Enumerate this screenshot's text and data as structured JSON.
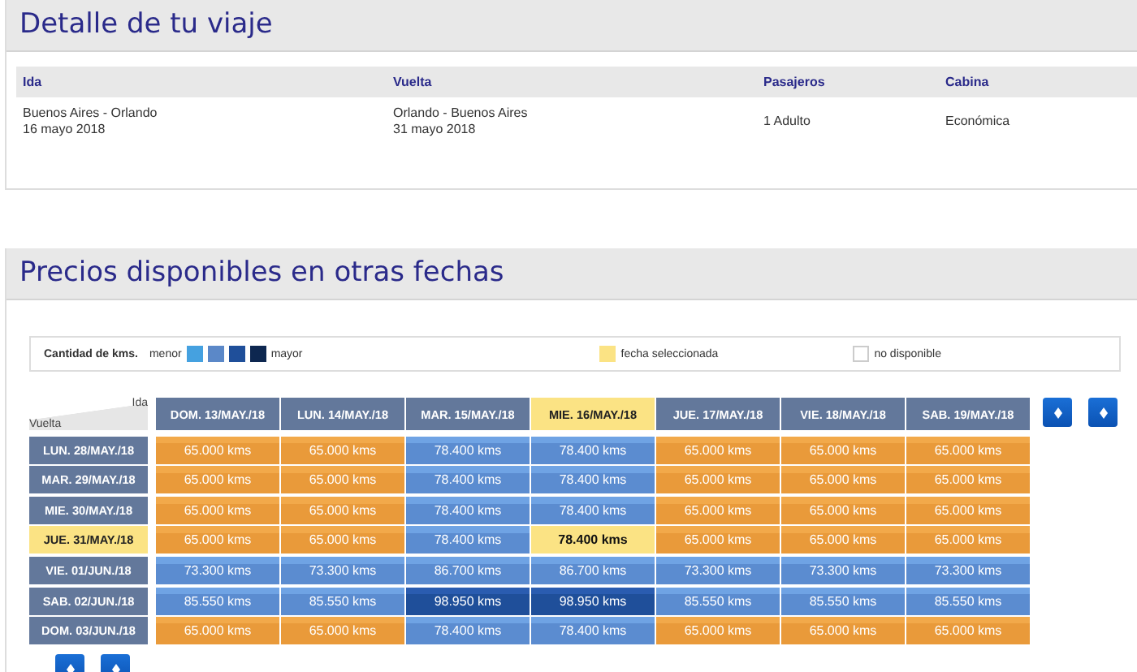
{
  "trip": {
    "title": "Detalle de tu viaje",
    "columns": [
      "Ida",
      "Vuelta",
      "Pasajeros",
      "Cabina"
    ],
    "values": [
      [
        "Buenos Aires - Orlando",
        "16 mayo 2018"
      ],
      [
        "Orlando - Buenos Aires",
        "31 mayo 2018"
      ],
      [
        "1 Adulto"
      ],
      [
        "Económica"
      ]
    ]
  },
  "prices": {
    "title": "Precios disponibles en otras fechas",
    "legend": {
      "label": "Cantidad de kms.",
      "low": "menor",
      "high": "mayor",
      "scale": [
        {
          "color": "#45a1e0"
        },
        {
          "color": "#5b88c8"
        },
        {
          "color": "#1f4f9a"
        },
        {
          "color": "#0d2750"
        }
      ],
      "selected": "fecha seleccionada",
      "unavailable": "no disponible"
    },
    "corner": {
      "top": "Ida",
      "bottom": "Vuelta"
    },
    "columns": [
      {
        "label": "DOM. 13/MAY./18",
        "selected": false
      },
      {
        "label": "LUN. 14/MAY./18",
        "selected": false
      },
      {
        "label": "MAR. 15/MAY./18",
        "selected": false
      },
      {
        "label": "MIE. 16/MAY./18",
        "selected": true
      },
      {
        "label": "JUE. 17/MAY./18",
        "selected": false
      },
      {
        "label": "VIE. 18/MAY./18",
        "selected": false
      },
      {
        "label": "SAB. 19/MAY./18",
        "selected": false
      }
    ],
    "rows": [
      {
        "label": "LUN. 28/MAY./18",
        "selected": false,
        "cells": [
          {
            "text": "65.000 kms",
            "kind": "promo",
            "selected": false
          },
          {
            "text": "65.000 kms",
            "kind": "promo",
            "selected": false
          },
          {
            "text": "78.400 kms",
            "kind": "mid",
            "selected": false
          },
          {
            "text": "78.400 kms",
            "kind": "mid",
            "selected": false
          },
          {
            "text": "65.000 kms",
            "kind": "promo",
            "selected": false
          },
          {
            "text": "65.000 kms",
            "kind": "promo",
            "selected": false
          },
          {
            "text": "65.000 kms",
            "kind": "promo",
            "selected": false
          }
        ]
      },
      {
        "label": "MAR. 29/MAY./18",
        "selected": false,
        "cells": [
          {
            "text": "65.000 kms",
            "kind": "promo",
            "selected": false
          },
          {
            "text": "65.000 kms",
            "kind": "promo",
            "selected": false
          },
          {
            "text": "78.400 kms",
            "kind": "mid",
            "selected": false
          },
          {
            "text": "78.400 kms",
            "kind": "mid",
            "selected": false
          },
          {
            "text": "65.000 kms",
            "kind": "promo",
            "selected": false
          },
          {
            "text": "65.000 kms",
            "kind": "promo",
            "selected": false
          },
          {
            "text": "65.000 kms",
            "kind": "promo",
            "selected": false
          }
        ]
      },
      {
        "label": "MIE. 30/MAY./18",
        "selected": false,
        "cells": [
          {
            "text": "65.000 kms",
            "kind": "promo",
            "selected": false
          },
          {
            "text": "65.000 kms",
            "kind": "promo",
            "selected": false
          },
          {
            "text": "78.400 kms",
            "kind": "mid",
            "selected": false
          },
          {
            "text": "78.400 kms",
            "kind": "mid",
            "selected": false
          },
          {
            "text": "65.000 kms",
            "kind": "promo",
            "selected": false
          },
          {
            "text": "65.000 kms",
            "kind": "promo",
            "selected": false
          },
          {
            "text": "65.000 kms",
            "kind": "promo",
            "selected": false
          }
        ]
      },
      {
        "label": "JUE. 31/MAY./18",
        "selected": true,
        "cells": [
          {
            "text": "65.000 kms",
            "kind": "promo",
            "selected": false
          },
          {
            "text": "65.000 kms",
            "kind": "promo",
            "selected": false
          },
          {
            "text": "78.400 kms",
            "kind": "mid",
            "selected": false
          },
          {
            "text": "78.400 kms",
            "kind": "mid",
            "selected": true
          },
          {
            "text": "65.000 kms",
            "kind": "promo",
            "selected": false
          },
          {
            "text": "65.000 kms",
            "kind": "promo",
            "selected": false
          },
          {
            "text": "65.000 kms",
            "kind": "promo",
            "selected": false
          }
        ]
      },
      {
        "label": "VIE. 01/JUN./18",
        "selected": false,
        "cells": [
          {
            "text": "73.300 kms",
            "kind": "mid",
            "selected": false
          },
          {
            "text": "73.300 kms",
            "kind": "mid",
            "selected": false
          },
          {
            "text": "86.700 kms",
            "kind": "mid",
            "selected": false
          },
          {
            "text": "86.700 kms",
            "kind": "mid",
            "selected": false
          },
          {
            "text": "73.300 kms",
            "kind": "mid",
            "selected": false
          },
          {
            "text": "73.300 kms",
            "kind": "mid",
            "selected": false
          },
          {
            "text": "73.300 kms",
            "kind": "mid",
            "selected": false
          }
        ]
      },
      {
        "label": "SAB. 02/JUN./18",
        "selected": false,
        "cells": [
          {
            "text": "85.550 kms",
            "kind": "mid",
            "selected": false
          },
          {
            "text": "85.550 kms",
            "kind": "mid",
            "selected": false
          },
          {
            "text": "98.950 kms",
            "kind": "high",
            "selected": false
          },
          {
            "text": "98.950 kms",
            "kind": "high",
            "selected": false
          },
          {
            "text": "85.550 kms",
            "kind": "mid",
            "selected": false
          },
          {
            "text": "85.550 kms",
            "kind": "mid",
            "selected": false
          },
          {
            "text": "85.550 kms",
            "kind": "mid",
            "selected": false
          }
        ]
      },
      {
        "label": "DOM. 03/JUN./18",
        "selected": false,
        "cells": [
          {
            "text": "65.000 kms",
            "kind": "promo",
            "selected": false
          },
          {
            "text": "65.000 kms",
            "kind": "promo",
            "selected": false
          },
          {
            "text": "78.400 kms",
            "kind": "mid",
            "selected": false
          },
          {
            "text": "78.400 kms",
            "kind": "mid",
            "selected": false
          },
          {
            "text": "65.000 kms",
            "kind": "promo",
            "selected": false
          },
          {
            "text": "65.000 kms",
            "kind": "promo",
            "selected": false
          },
          {
            "text": "65.000 kms",
            "kind": "promo",
            "selected": false
          }
        ]
      }
    ]
  }
}
